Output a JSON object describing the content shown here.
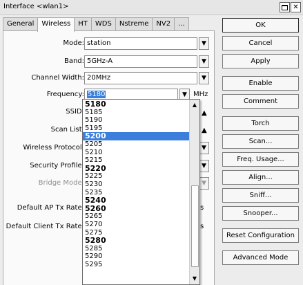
{
  "window": {
    "title": "Interface <wlan1>",
    "maximize_icon": "maximize-icon",
    "close_icon": "close-icon",
    "close_glyph": "✕"
  },
  "tabs": [
    {
      "label": "General",
      "active": false
    },
    {
      "label": "Wireless",
      "active": true
    },
    {
      "label": "HT",
      "active": false
    },
    {
      "label": "WDS",
      "active": false
    },
    {
      "label": "Nstreme",
      "active": false
    },
    {
      "label": "NV2",
      "active": false
    },
    {
      "label": "...",
      "active": false
    }
  ],
  "form": {
    "mode": {
      "label": "Mode:",
      "value": "station"
    },
    "band": {
      "label": "Band:",
      "value": "5GHz-A"
    },
    "channel_width": {
      "label": "Channel Width:",
      "value": "20MHz"
    },
    "frequency": {
      "label": "Frequency:",
      "value": "5180",
      "unit": "MHz"
    },
    "ssid": {
      "label": "SSID:"
    },
    "scan_list": {
      "label": "Scan List:"
    },
    "wireless_protocol": {
      "label": "Wireless Protocol:"
    },
    "security_profile": {
      "label": "Security Profile:"
    },
    "bridge_mode": {
      "label": "Bridge Mode:"
    },
    "default_ap_tx_rate": {
      "label": "Default AP Tx Rate:",
      "unit_fragment": "s"
    },
    "default_client_tx_rate": {
      "label": "Default Client Tx Rate:",
      "unit_fragment": "s"
    }
  },
  "icons": {
    "dropdown_glyph": "▼",
    "scroll_up_glyph": "▲",
    "scroll_down_glyph": "▼",
    "dropdown_icon": "chevron-down-icon"
  },
  "frequency_list": {
    "scroll_thumb_start_fraction": 0.46,
    "scroll_thumb_end_fraction": 0.96,
    "items": [
      {
        "value": "5180",
        "bold": true,
        "selected": false
      },
      {
        "value": "5185",
        "bold": false,
        "selected": false
      },
      {
        "value": "5190",
        "bold": false,
        "selected": false
      },
      {
        "value": "5195",
        "bold": false,
        "selected": false
      },
      {
        "value": "5200",
        "bold": true,
        "selected": true
      },
      {
        "value": "5205",
        "bold": false,
        "selected": false
      },
      {
        "value": "5210",
        "bold": false,
        "selected": false
      },
      {
        "value": "5215",
        "bold": false,
        "selected": false
      },
      {
        "value": "5220",
        "bold": true,
        "selected": false
      },
      {
        "value": "5225",
        "bold": false,
        "selected": false
      },
      {
        "value": "5230",
        "bold": false,
        "selected": false
      },
      {
        "value": "5235",
        "bold": false,
        "selected": false
      },
      {
        "value": "5240",
        "bold": true,
        "selected": false
      },
      {
        "value": "5260",
        "bold": true,
        "selected": false
      },
      {
        "value": "5265",
        "bold": false,
        "selected": false
      },
      {
        "value": "5270",
        "bold": false,
        "selected": false
      },
      {
        "value": "5275",
        "bold": false,
        "selected": false
      },
      {
        "value": "5280",
        "bold": true,
        "selected": false
      },
      {
        "value": "5285",
        "bold": false,
        "selected": false
      },
      {
        "value": "5290",
        "bold": false,
        "selected": false
      },
      {
        "value": "5295",
        "bold": false,
        "selected": false
      }
    ]
  },
  "buttons": [
    {
      "label": "OK",
      "name": "ok-button",
      "default": true
    },
    {
      "label": "Cancel",
      "name": "cancel-button",
      "default": false
    },
    {
      "label": "Apply",
      "name": "apply-button",
      "default": false
    },
    {
      "label": "Enable",
      "name": "enable-button",
      "default": false
    },
    {
      "label": "Comment",
      "name": "comment-button",
      "default": false
    },
    {
      "label": "Torch",
      "name": "torch-button",
      "default": false
    },
    {
      "label": "Scan...",
      "name": "scan-button",
      "default": false
    },
    {
      "label": "Freq. Usage...",
      "name": "freq-usage-button",
      "default": false
    },
    {
      "label": "Align...",
      "name": "align-button",
      "default": false
    },
    {
      "label": "Sniff...",
      "name": "sniff-button",
      "default": false
    },
    {
      "label": "Snooper...",
      "name": "snooper-button",
      "default": false
    },
    {
      "label": "Reset Configuration",
      "name": "reset-configuration-button",
      "default": false
    },
    {
      "label": "Advanced Mode",
      "name": "advanced-mode-button",
      "default": false
    }
  ],
  "colors": {
    "selection": "#3b7fdc",
    "window_bg": "#ececec",
    "panel_bg": "#fafafa"
  }
}
